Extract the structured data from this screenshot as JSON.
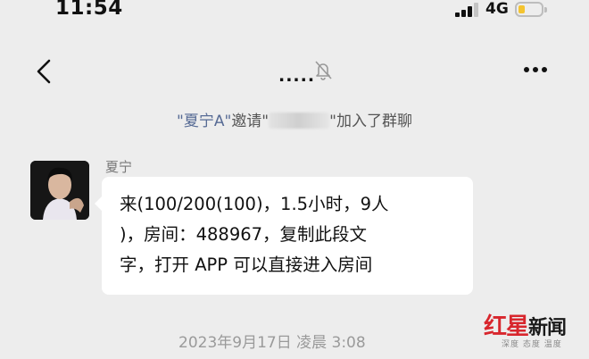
{
  "status_bar": {
    "time": "11:54",
    "network": "4G",
    "battery_level": 0.3
  },
  "nav": {
    "title": ".....",
    "back_icon": "chevron-left-icon",
    "mute_icon": "bell-off-icon",
    "more_icon": "ellipsis-icon"
  },
  "system_message": {
    "inviter": "\"夏宁A\"",
    "action_prefix": "邀请\"",
    "invitee": "",
    "action_suffix": "\"加入了群聊"
  },
  "message": {
    "sender": "夏宁",
    "text": "来(100/200(100)，1.5小时，9人\n)，房间：488967，复制此段文\n字，打开 APP 可以直接进入房间"
  },
  "timestamp": "2023年9月17日 凌晨 3:08",
  "watermark": {
    "brand": "红星",
    "brand_news": "新闻",
    "slogan": "深度 态度 温度"
  },
  "colors": {
    "background": "#ededed",
    "bubble": "#ffffff",
    "nickname_link": "#576b95",
    "battery": "#f4c430",
    "watermark_red": "#d8262d"
  }
}
